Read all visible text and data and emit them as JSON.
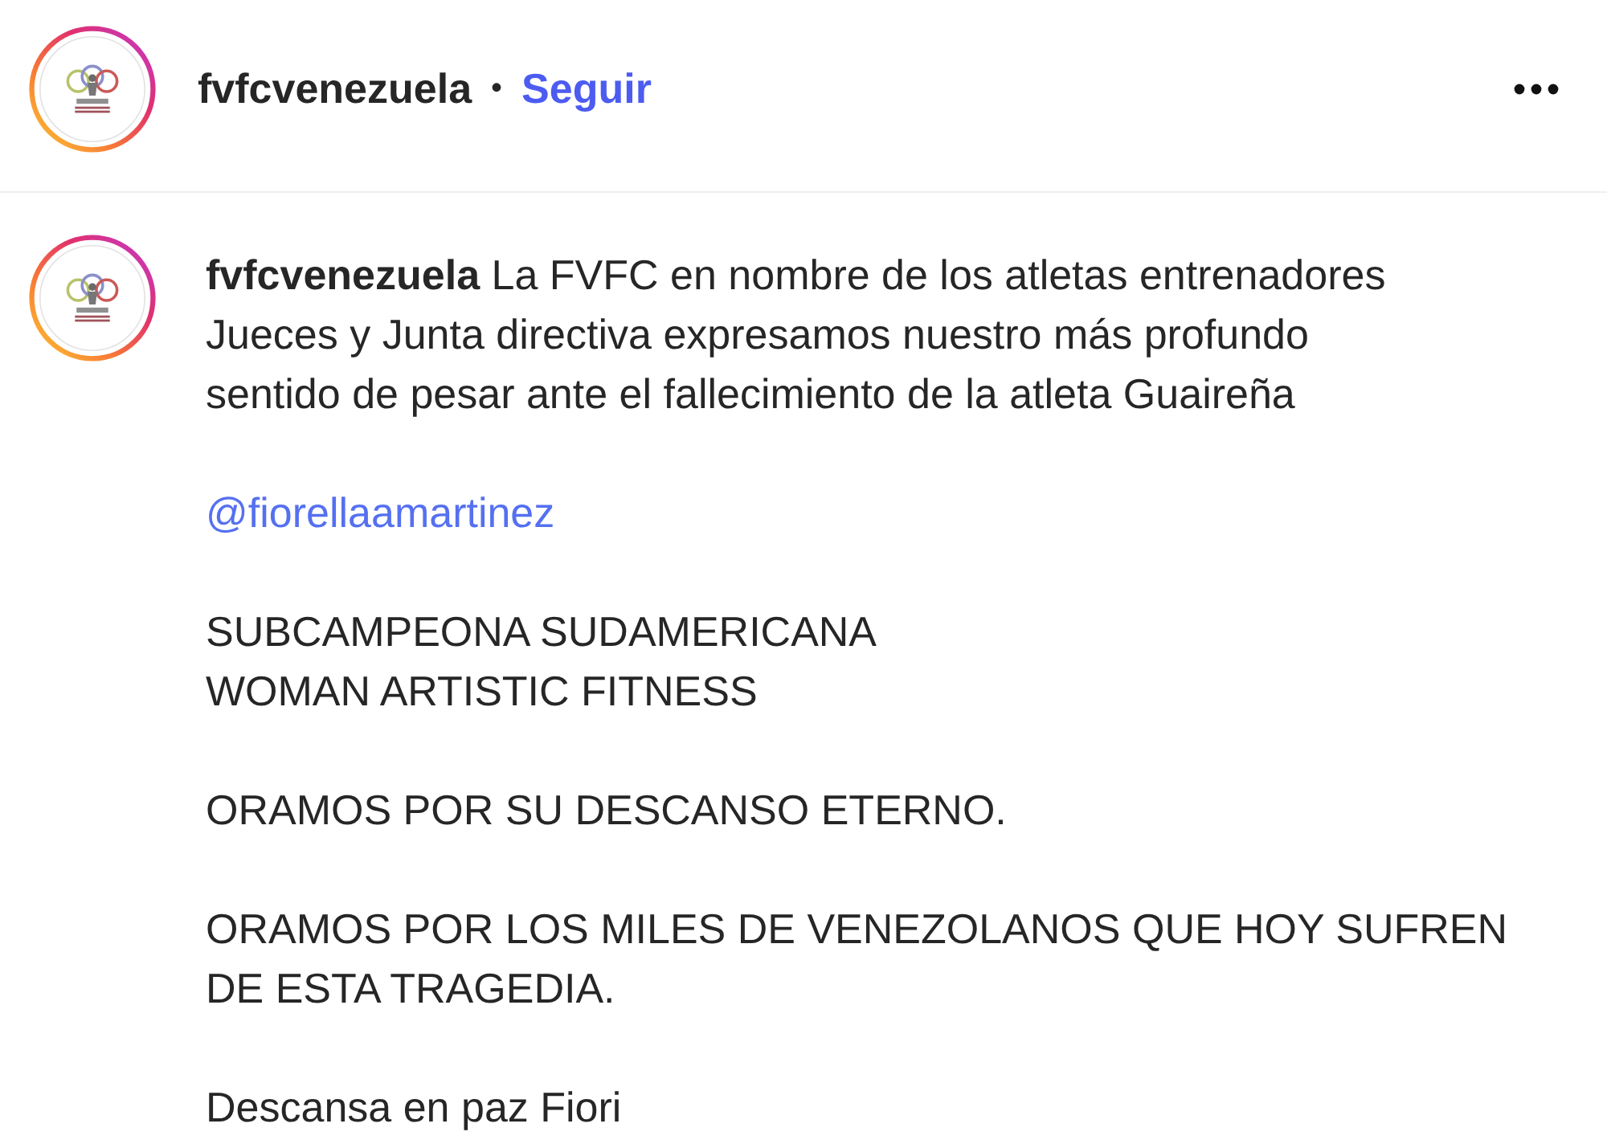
{
  "post_header": {
    "username": "fvfcvenezuela",
    "separator": "•",
    "follow_label": "Seguir"
  },
  "caption": {
    "username": "fvfcvenezuela",
    "paragraphs": [
      {
        "kind": "text",
        "lines": [
          "La FVFC en nombre de los atletas entrenadores",
          "Jueces y Junta directiva expresamos nuestro más profundo",
          "sentido de pesar ante el fallecimiento de la atleta Guaireña"
        ]
      },
      {
        "kind": "mention",
        "lines": [
          "@fiorellaamartinez"
        ]
      },
      {
        "kind": "text",
        "lines": [
          "SUBCAMPEONA SUDAMERICANA",
          "WOMAN ARTISTIC FITNESS"
        ]
      },
      {
        "kind": "text",
        "lines": [
          "ORAMOS POR SU DESCANSO ETERNO."
        ]
      },
      {
        "kind": "text",
        "lines": [
          "ORAMOS POR LOS MILES DE VENEZOLANOS QUE HOY SUFREN",
          "DE ESTA TRAGEDIA."
        ]
      },
      {
        "kind": "text",
        "lines": [
          "Descansa en paz Fiori"
        ]
      }
    ]
  }
}
